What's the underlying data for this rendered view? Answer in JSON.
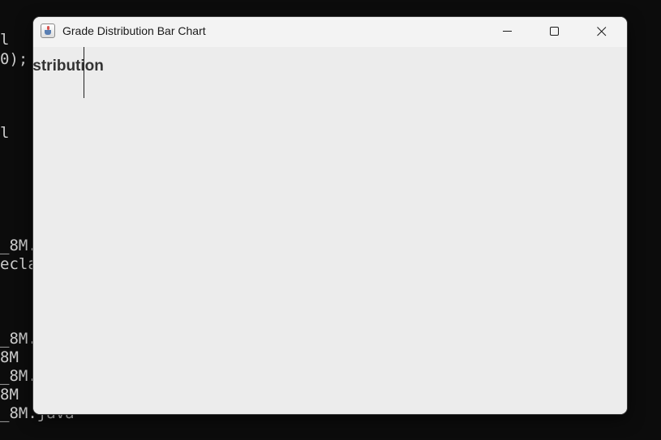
{
  "terminal": {
    "lines": [
      {
        "text": "l"
      },
      {
        "text": "0);"
      },
      {
        "text": "l"
      },
      {
        "text": "_8M."
      },
      {
        "text": "ecla"
      },
      {
        "text": "_8M."
      },
      {
        "text": "8M"
      },
      {
        "text": "_8M."
      },
      {
        "text": "8M"
      },
      {
        "text": "_8M.java"
      }
    ]
  },
  "window": {
    "title": "Grade Distribution Bar Chart",
    "icon": "java-app-icon",
    "controls": {
      "minimize": "minimize-icon",
      "maximize": "maximize-icon",
      "close": "close-icon"
    }
  },
  "chart": {
    "title_visible": "istribution"
  }
}
